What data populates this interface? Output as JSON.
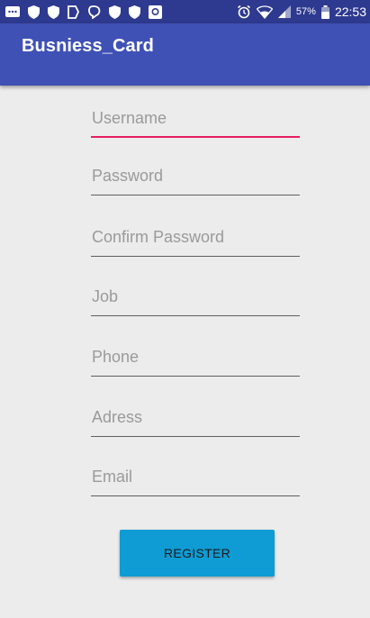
{
  "status_bar": {
    "battery_percent": "57%",
    "time": "22:53"
  },
  "app_bar": {
    "title": "Busniess_Card"
  },
  "form": {
    "fields": [
      {
        "placeholder": "Username",
        "value": "",
        "focused": true
      },
      {
        "placeholder": "Password",
        "value": ""
      },
      {
        "placeholder": "Confirm Password",
        "value": ""
      },
      {
        "placeholder": "Job",
        "value": ""
      },
      {
        "placeholder": "Phone",
        "value": ""
      },
      {
        "placeholder": "Adress",
        "value": ""
      },
      {
        "placeholder": "Email",
        "value": ""
      }
    ],
    "register_label": "REGISTER"
  },
  "colors": {
    "status_bar": "#2e3a8f",
    "app_bar": "#3f51b5",
    "focus_accent": "#e91e63",
    "button": "#0f9bd3",
    "background": "#ececec"
  }
}
